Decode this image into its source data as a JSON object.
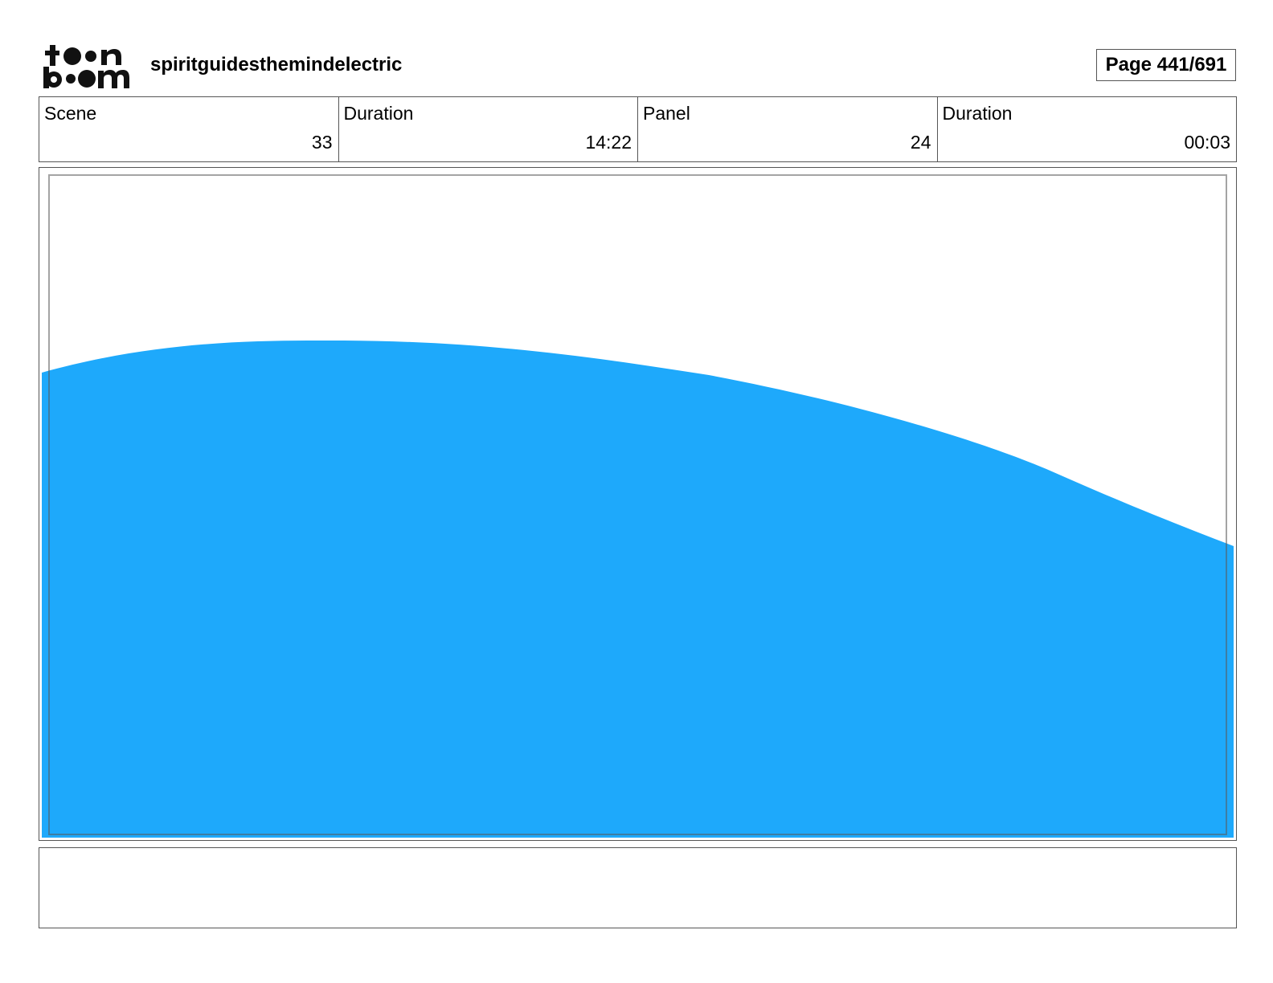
{
  "header": {
    "logo_name": "toon-boom-logo",
    "project_title": "spiritguidesthemindelectric",
    "page_label": "Page 441/691"
  },
  "info": {
    "scene_label": "Scene",
    "scene_value": "33",
    "scene_duration_label": "Duration",
    "scene_duration_value": "14:22",
    "panel_label": "Panel",
    "panel_value": "24",
    "panel_duration_label": "Duration",
    "panel_duration_value": "00:03"
  },
  "panel": {
    "fill_color": "#1ea9fb"
  },
  "notes": {
    "text": ""
  }
}
